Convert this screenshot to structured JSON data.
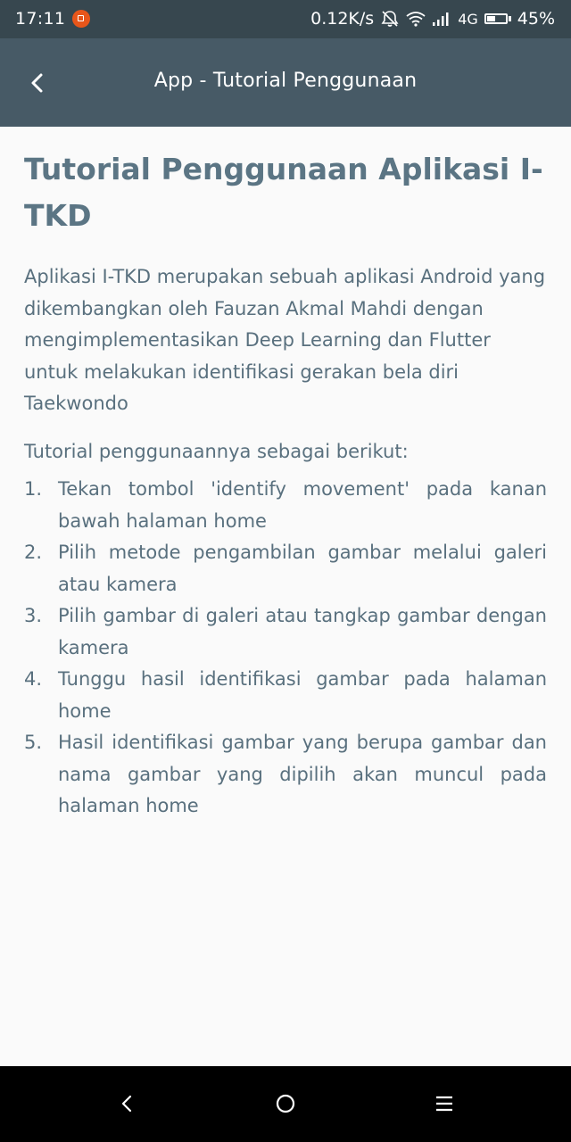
{
  "status_bar": {
    "time": "17:11",
    "network_speed": "0.12K/s",
    "network_type": "4G",
    "battery_percent": "45%",
    "battery_level": 0.45,
    "notification_color": "#e8561a",
    "icons": [
      "notification-icon",
      "alarm-off-icon",
      "wifi-icon",
      "signal-icon",
      "battery-icon"
    ]
  },
  "app_bar": {
    "title": "App - Tutorial Penggunaan",
    "back_icon": "chevron-left-icon",
    "background": "#475a66"
  },
  "content": {
    "title": "Tutorial Penggunaan Aplikasi I-TKD",
    "intro": "Aplikasi I-TKD merupakan sebuah aplikasi Android yang dikembangkan oleh Fauzan Akmal Mahdi dengan mengimplementasikan Deep Learning dan Flutter untuk melakukan identifikasi gerakan bela diri Taekwondo",
    "steps_heading": "Tutorial penggunaannya sebagai berikut:",
    "steps": [
      {
        "num": "1.",
        "text": "Tekan tombol 'identify movement' pada kanan bawah halaman home"
      },
      {
        "num": "2.",
        "text": "Pilih metode pengambilan gambar melalui galeri atau kamera"
      },
      {
        "num": "3.",
        "text": "Pilih gambar di galeri atau tangkap gambar dengan kamera"
      },
      {
        "num": "4.",
        "text": "Tunggu hasil identifikasi gambar pada halaman home"
      },
      {
        "num": "5.",
        "text": "Hasil identifikasi gambar yang berupa gambar dan nama gambar yang dipilih akan muncul pada halaman home"
      }
    ]
  },
  "nav_bar": {
    "icons": [
      "back-nav-icon",
      "home-nav-icon",
      "menu-nav-icon"
    ]
  }
}
